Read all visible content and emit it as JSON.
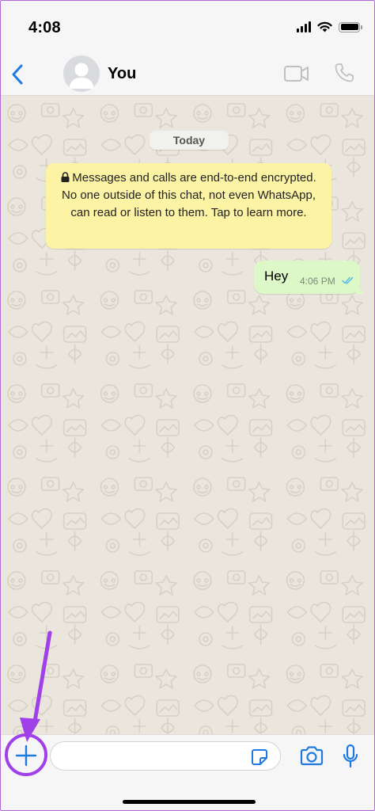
{
  "status_bar": {
    "time": "4:08",
    "battery_level": 1.0
  },
  "header": {
    "contact_name": "You",
    "back_icon": "chevron-left-icon",
    "avatar_icon": "default-avatar-icon",
    "video_icon": "video-camera-icon",
    "call_icon": "phone-icon",
    "accent_color": "#1f7ae0"
  },
  "chat": {
    "date_label": "Today",
    "encryption_notice": "Messages and calls are end-to-end encrypted. No one outside of this chat, not even WhatsApp, can read or listen to them. Tap to learn more.",
    "messages": [
      {
        "direction": "outgoing",
        "text": "Hey",
        "time": "4:06 PM",
        "status": "read"
      }
    ],
    "notice_color": "#fdf3a5",
    "outgoing_bubble_color": "#dcf8c6",
    "wallpaper_color": "#ebe6dd"
  },
  "input_bar": {
    "attach_icon": "plus-icon",
    "message_value": "",
    "message_placeholder": "",
    "sticker_icon": "sticker-icon",
    "camera_icon": "camera-icon",
    "mic_icon": "microphone-icon"
  },
  "annotation": {
    "color": "#a040e8",
    "target": "attach-button"
  }
}
